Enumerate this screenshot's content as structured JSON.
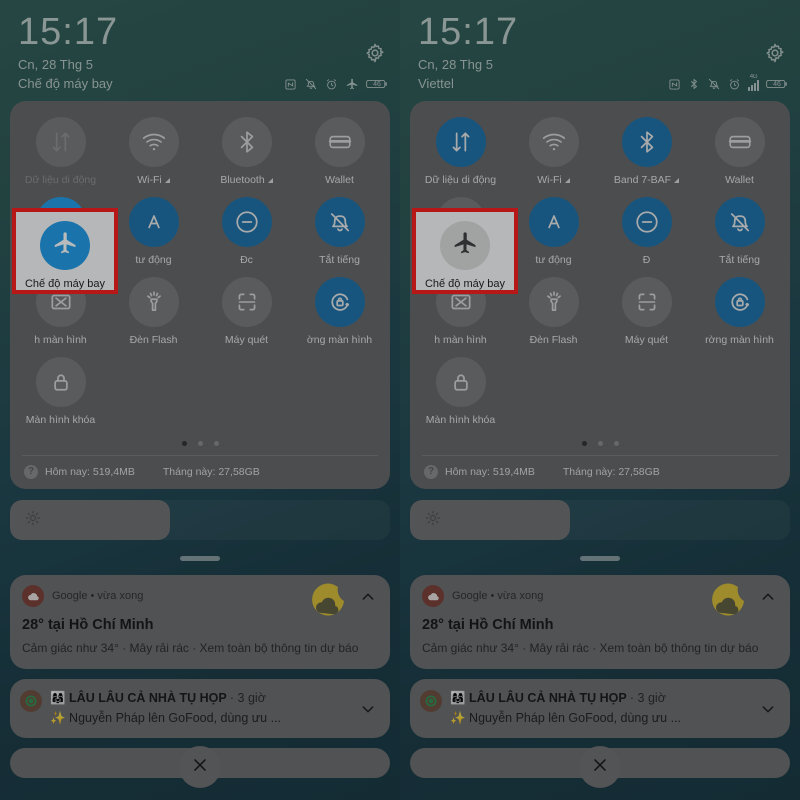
{
  "panels": [
    {
      "id": "left",
      "status": {
        "time": "15:17",
        "date": "Cn, 28 Thg 5",
        "carrier": "Chế độ máy bay",
        "battery": "46",
        "icons": [
          "nfc-icon",
          "mute-icon",
          "alarm-icon",
          "airplane-icon",
          "battery-icon"
        ],
        "show_bluetooth": false,
        "show_signal": false,
        "network_label": ""
      },
      "tiles": [
        {
          "label": "Dữ liệu di động",
          "icon": "mobile-data-icon",
          "state": "disabled",
          "caret": false
        },
        {
          "label": "Wi-Fi",
          "icon": "wifi-icon",
          "state": "off",
          "caret": true
        },
        {
          "label": "Bluetooth",
          "icon": "bluetooth-icon",
          "state": "off",
          "caret": true
        },
        {
          "label": "Wallet",
          "icon": "wallet-icon",
          "state": "off",
          "caret": false
        },
        {
          "label": "Chế độ máy bay",
          "icon": "airplane-icon",
          "state": "airplane-on",
          "caret": false
        },
        {
          "label": "tư động",
          "icon": "auto-brightness-icon",
          "state": "on",
          "caret": false
        },
        {
          "label": "Đc",
          "icon": "dnd-icon",
          "state": "on",
          "caret": false
        },
        {
          "label": "Tắt tiếng",
          "icon": "mute-bell-icon",
          "state": "on",
          "caret": false
        },
        {
          "label": "h màn hình",
          "icon": "screenshot-icon",
          "state": "off",
          "caret": false
        },
        {
          "label": "Đèn Flash",
          "icon": "flashlight-icon",
          "state": "off",
          "caret": false
        },
        {
          "label": "Máy quét",
          "icon": "scanner-icon",
          "state": "off",
          "caret": false
        },
        {
          "label": "ờng màn hình",
          "icon": "screen-rotation-lock-icon",
          "state": "on",
          "caret": false
        },
        {
          "label": "Màn hình khóa",
          "icon": "lock-icon",
          "state": "off",
          "caret": false
        }
      ],
      "pages": {
        "count": 3,
        "active": 0
      },
      "usage": {
        "today_label": "Hôm nay: 519,4MB",
        "month_label": "Tháng này: 27,58GB",
        "help": "?"
      },
      "brightness": {
        "icon": "brightness-icon",
        "value_percent": 42
      },
      "notifications": [
        {
          "type": "weather",
          "app": "Google",
          "time": "vừa xong",
          "separator": "•",
          "title": "28° tại Hồ Chí Minh",
          "body": "Cảm giác như 34° · Mây rải rác · Xem toàn bộ thông tin dự báo",
          "expand_icon": "chevron-up-icon",
          "weather_icon": "moon-cloud-icon"
        },
        {
          "type": "chat",
          "line1": "👩‍👩‍👧 LÂU LÂU CẢ NHÀ TỤ HỌP",
          "separator": "·",
          "time": "3 giờ",
          "line2": "✨ Nguyễn Pháp lên GoFood, dùng ưu ...",
          "expand_icon": "chevron-down-icon"
        }
      ],
      "close_button": {
        "icon": "close-icon"
      },
      "highlight": {
        "label": "Chế độ máy bay",
        "icon": "airplane-icon",
        "state": "airplane-on"
      }
    },
    {
      "id": "right",
      "status": {
        "time": "15:17",
        "date": "Cn, 28 Thg 5",
        "carrier": "Viettel",
        "battery": "46",
        "icons": [
          "nfc-icon",
          "bluetooth-icon",
          "mute-icon",
          "alarm-icon",
          "signal-icon",
          "battery-icon"
        ],
        "show_bluetooth": true,
        "show_signal": true,
        "network_label": "4G"
      },
      "tiles": [
        {
          "label": "Dữ liệu di động",
          "icon": "mobile-data-icon",
          "state": "on",
          "caret": false
        },
        {
          "label": "Wi-Fi",
          "icon": "wifi-icon",
          "state": "off",
          "caret": true
        },
        {
          "label": "Band 7-BAF",
          "icon": "bluetooth-icon",
          "state": "on",
          "caret": true
        },
        {
          "label": "Wallet",
          "icon": "wallet-icon",
          "state": "off",
          "caret": false
        },
        {
          "label": "Chế độ máy bay",
          "icon": "airplane-icon",
          "state": "off",
          "caret": false
        },
        {
          "label": "tư động",
          "icon": "auto-brightness-icon",
          "state": "on",
          "caret": false
        },
        {
          "label": "Đ",
          "icon": "dnd-icon",
          "state": "on",
          "caret": false
        },
        {
          "label": "Tắt tiếng",
          "icon": "mute-bell-icon",
          "state": "on",
          "caret": false
        },
        {
          "label": "h màn hình",
          "icon": "screenshot-icon",
          "state": "off",
          "caret": false
        },
        {
          "label": "Đèn Flash",
          "icon": "flashlight-icon",
          "state": "off",
          "caret": false
        },
        {
          "label": "Máy quét",
          "icon": "scanner-icon",
          "state": "off",
          "caret": false
        },
        {
          "label": "rờng màn hình",
          "icon": "screen-rotation-lock-icon",
          "state": "on",
          "caret": false
        },
        {
          "label": "Màn hình khóa",
          "icon": "lock-icon",
          "state": "off",
          "caret": false
        }
      ],
      "pages": {
        "count": 3,
        "active": 0
      },
      "usage": {
        "today_label": "Hôm nay: 519,4MB",
        "month_label": "Tháng này: 27,58GB",
        "help": "?"
      },
      "brightness": {
        "icon": "brightness-icon",
        "value_percent": 42
      },
      "notifications": [
        {
          "type": "weather",
          "app": "Google",
          "time": "vừa xong",
          "separator": "•",
          "title": "28° tại Hồ Chí Minh",
          "body": "Cảm giác như 34° · Mây rải rác · Xem toàn bộ thông tin dự báo",
          "expand_icon": "chevron-up-icon",
          "weather_icon": "moon-cloud-icon"
        },
        {
          "type": "chat",
          "line1": "👩‍👩‍👧 LÂU LÂU CẢ NHÀ TỤ HỌP",
          "separator": "·",
          "time": "3 giờ",
          "line2": "✨ Nguyễn Pháp lên GoFood, dùng ưu ...",
          "expand_icon": "chevron-down-icon"
        }
      ],
      "close_button": {
        "icon": "close-icon"
      },
      "highlight": {
        "label": "Chế độ máy bay",
        "icon": "airplane-icon",
        "state": "off"
      }
    }
  ],
  "colors": {
    "accent_on": "#1a6fa8",
    "accent_airplane_active": "#1f9ae8",
    "tile_off": "#777777",
    "panel_bg": "#646464",
    "highlight_border": "#ff1616",
    "highlight_fill": "#fbfbfb",
    "weather_icon": "#d8bc33",
    "background_start": "#2e5a54",
    "background_end": "#15333e"
  }
}
